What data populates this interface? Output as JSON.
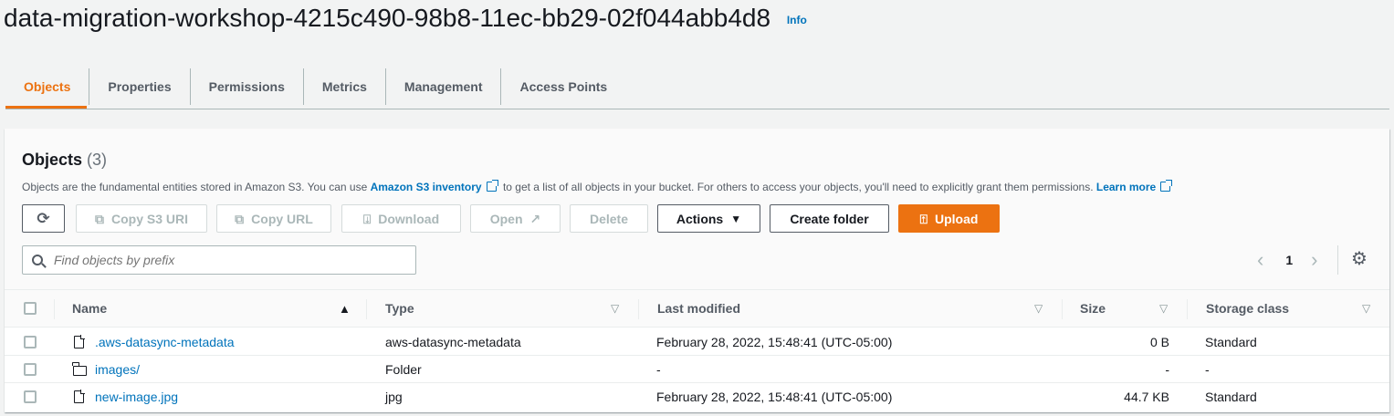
{
  "bucket": {
    "name": "data-migration-workshop-4215c490-98b8-11ec-bb29-02f044abb4d8",
    "info_label": "Info"
  },
  "tabs": [
    {
      "label": "Objects",
      "active": true
    },
    {
      "label": "Properties"
    },
    {
      "label": "Permissions"
    },
    {
      "label": "Metrics"
    },
    {
      "label": "Management"
    },
    {
      "label": "Access Points"
    }
  ],
  "objects_panel": {
    "title": "Objects",
    "count": "(3)",
    "description": {
      "part1": "Objects are the fundamental entities stored in Amazon S3. You can use ",
      "link1": "Amazon S3 inventory",
      "part2": " to get a list of all objects in your bucket. For others to access your objects, you'll need to explicitly grant them permissions. ",
      "link2": "Learn more"
    }
  },
  "toolbar": {
    "copy_s3_uri": "Copy S3 URI",
    "copy_url": "Copy URL",
    "download": "Download",
    "open": "Open",
    "delete": "Delete",
    "actions": "Actions",
    "create_folder": "Create folder",
    "upload": "Upload"
  },
  "search": {
    "placeholder": "Find objects by prefix"
  },
  "pagination": {
    "page": "1"
  },
  "table": {
    "columns": {
      "name": "Name",
      "type": "Type",
      "last_modified": "Last modified",
      "size": "Size",
      "storage_class": "Storage class"
    },
    "rows": [
      {
        "icon": "file-icon",
        "name": ".aws-datasync-metadata",
        "type": "aws-datasync-metadata",
        "last_modified": "February 28, 2022, 15:48:41 (UTC-05:00)",
        "size": "0 B",
        "storage_class": "Standard"
      },
      {
        "icon": "folder-icon",
        "name": "images/",
        "type": "Folder",
        "last_modified": "-",
        "size": "-",
        "storage_class": "-"
      },
      {
        "icon": "file-icon",
        "name": "new-image.jpg",
        "type": "jpg",
        "last_modified": "February 28, 2022, 15:48:41 (UTC-05:00)",
        "size": "44.7 KB",
        "storage_class": "Standard"
      }
    ]
  },
  "colors": {
    "accent": "#ec7211",
    "link": "#0073bb",
    "text": "#16191f",
    "muted": "#545b64"
  }
}
